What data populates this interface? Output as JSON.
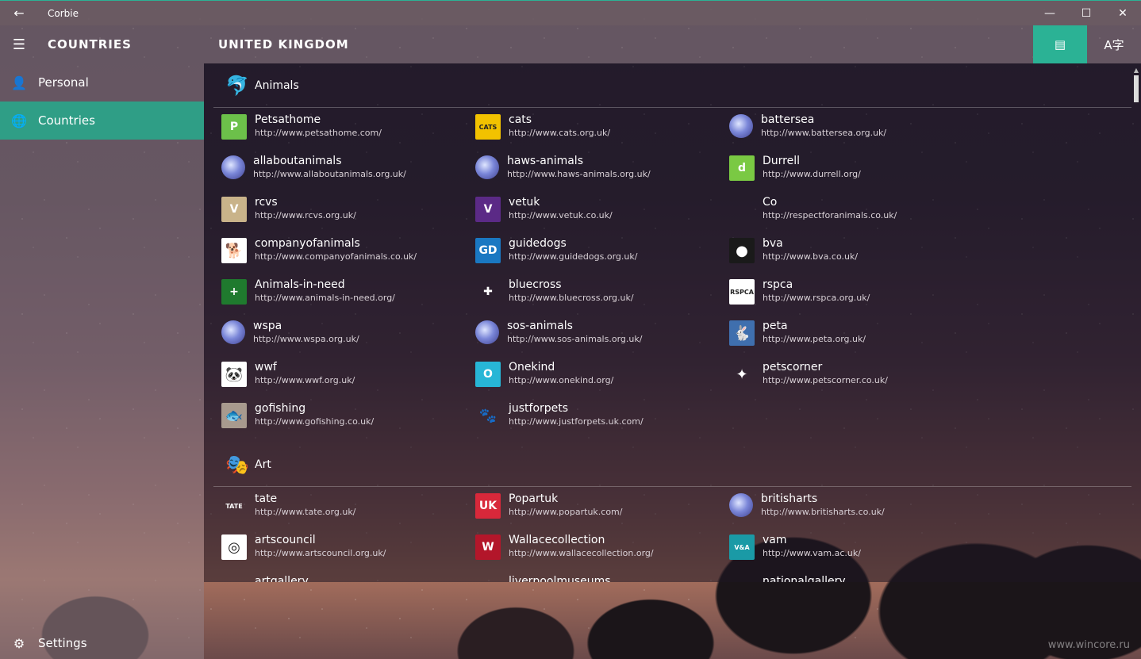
{
  "window": {
    "title": "Corbie",
    "buttons": [
      "—",
      "☐",
      "✕"
    ]
  },
  "sidebar": {
    "title": "COUNTRIES",
    "items": [
      {
        "label": "Personal",
        "icon": "person-icon"
      },
      {
        "label": "Countries",
        "icon": "globe-icon",
        "active": true
      }
    ],
    "settings_label": "Settings"
  },
  "header": {
    "title": "UNITED KINGDOM",
    "actions": [
      "card-view-icon",
      "language-icon"
    ]
  },
  "sections": [
    {
      "title": "Animals",
      "icon": "dolphin-icon",
      "items": [
        {
          "name": "Petsathome",
          "url": "http://www.petsathome.com/",
          "logo": "P",
          "color": "#6cc04a"
        },
        {
          "name": "cats",
          "url": "http://www.cats.org.uk/",
          "logo": "CATS",
          "color": "#f2c200"
        },
        {
          "name": "battersea",
          "url": "http://www.battersea.org.uk/",
          "logo": "globe",
          "color": "#2b3a8c"
        },
        {
          "name": "allaboutanimals",
          "url": "http://www.allaboutanimals.org.uk/",
          "logo": "globe",
          "color": ""
        },
        {
          "name": "haws-animals",
          "url": "http://www.haws-animals.org.uk/",
          "logo": "globe",
          "color": ""
        },
        {
          "name": "Durrell",
          "url": "http://www.durrell.org/",
          "logo": "d",
          "color": "#7ac943"
        },
        {
          "name": "rcvs",
          "url": "http://www.rcvs.org.uk/",
          "logo": "V",
          "color": "#c9b38a"
        },
        {
          "name": "vetuk",
          "url": "http://www.vetuk.co.uk/",
          "logo": "V",
          "color": "#5b2a86"
        },
        {
          "name": "Co",
          "url": "http://respectforanimals.co.uk/",
          "logo": "",
          "color": "transparent"
        },
        {
          "name": "companyofanimals",
          "url": "http://www.companyofanimals.co.uk/",
          "logo": "dog",
          "color": "#ffffff"
        },
        {
          "name": "guidedogs",
          "url": "http://www.guidedogs.org.uk/",
          "logo": "GD",
          "color": "#1a78c2"
        },
        {
          "name": "bva",
          "url": "http://www.bva.co.uk/",
          "logo": "bva",
          "color": "#1a1a1a"
        },
        {
          "name": "Animals-in-need",
          "url": "http://www.animals-in-need.org/",
          "logo": "+",
          "color": "#1f7a2e"
        },
        {
          "name": "bluecross",
          "url": "http://www.bluecross.org.uk/",
          "logo": "✚",
          "color": "transparent"
        },
        {
          "name": "rspca",
          "url": "http://www.rspca.org.uk/",
          "logo": "RSPCA",
          "color": "#ffffff"
        },
        {
          "name": "wspa",
          "url": "http://www.wspa.org.uk/",
          "logo": "globe",
          "color": ""
        },
        {
          "name": "sos-animals",
          "url": "http://www.sos-animals.org.uk/",
          "logo": "globe",
          "color": ""
        },
        {
          "name": "peta",
          "url": "http://www.peta.org.uk/",
          "logo": "peta",
          "color": "#3f6fae"
        },
        {
          "name": "wwf",
          "url": "http://www.wwf.org.uk/",
          "logo": "panda",
          "color": "#ffffff"
        },
        {
          "name": "Onekind",
          "url": "http://www.onekind.org/",
          "logo": "O",
          "color": "#27b6d6"
        },
        {
          "name": "petscorner",
          "url": "http://www.petscorner.co.uk/",
          "logo": "pc",
          "color": "transparent"
        },
        {
          "name": "gofishing",
          "url": "http://www.gofishing.co.uk/",
          "logo": "fish",
          "color": "#a89a8e"
        },
        {
          "name": "justforpets",
          "url": "http://www.justforpets.uk.com/",
          "logo": "paw",
          "color": "transparent"
        }
      ]
    },
    {
      "title": "Art",
      "icon": "mask-icon",
      "items": [
        {
          "name": "tate",
          "url": "http://www.tate.org.uk/",
          "logo": "TATE",
          "color": "transparent"
        },
        {
          "name": "Popartuk",
          "url": "http://www.popartuk.com/",
          "logo": "UK",
          "color": "#d8283a"
        },
        {
          "name": "britisharts",
          "url": "http://www.britisharts.co.uk/",
          "logo": "globe",
          "color": ""
        },
        {
          "name": "artscouncil",
          "url": "http://www.artscouncil.org.uk/",
          "logo": "ring",
          "color": "#ffffff"
        },
        {
          "name": "Wallacecollection",
          "url": "http://www.wallacecollection.org/",
          "logo": "W",
          "color": "#b3162a"
        },
        {
          "name": "vam",
          "url": "http://www.vam.ac.uk/",
          "logo": "V&A",
          "color": "#1a9aa6"
        },
        {
          "name": "artgallery",
          "url": "",
          "logo": "",
          "color": "transparent"
        },
        {
          "name": "liverpoolmuseums",
          "url": "",
          "logo": "",
          "color": "transparent"
        },
        {
          "name": "nationalgallery",
          "url": "",
          "logo": "",
          "color": "transparent"
        }
      ]
    }
  ],
  "watermark": "www.wincore.ru"
}
